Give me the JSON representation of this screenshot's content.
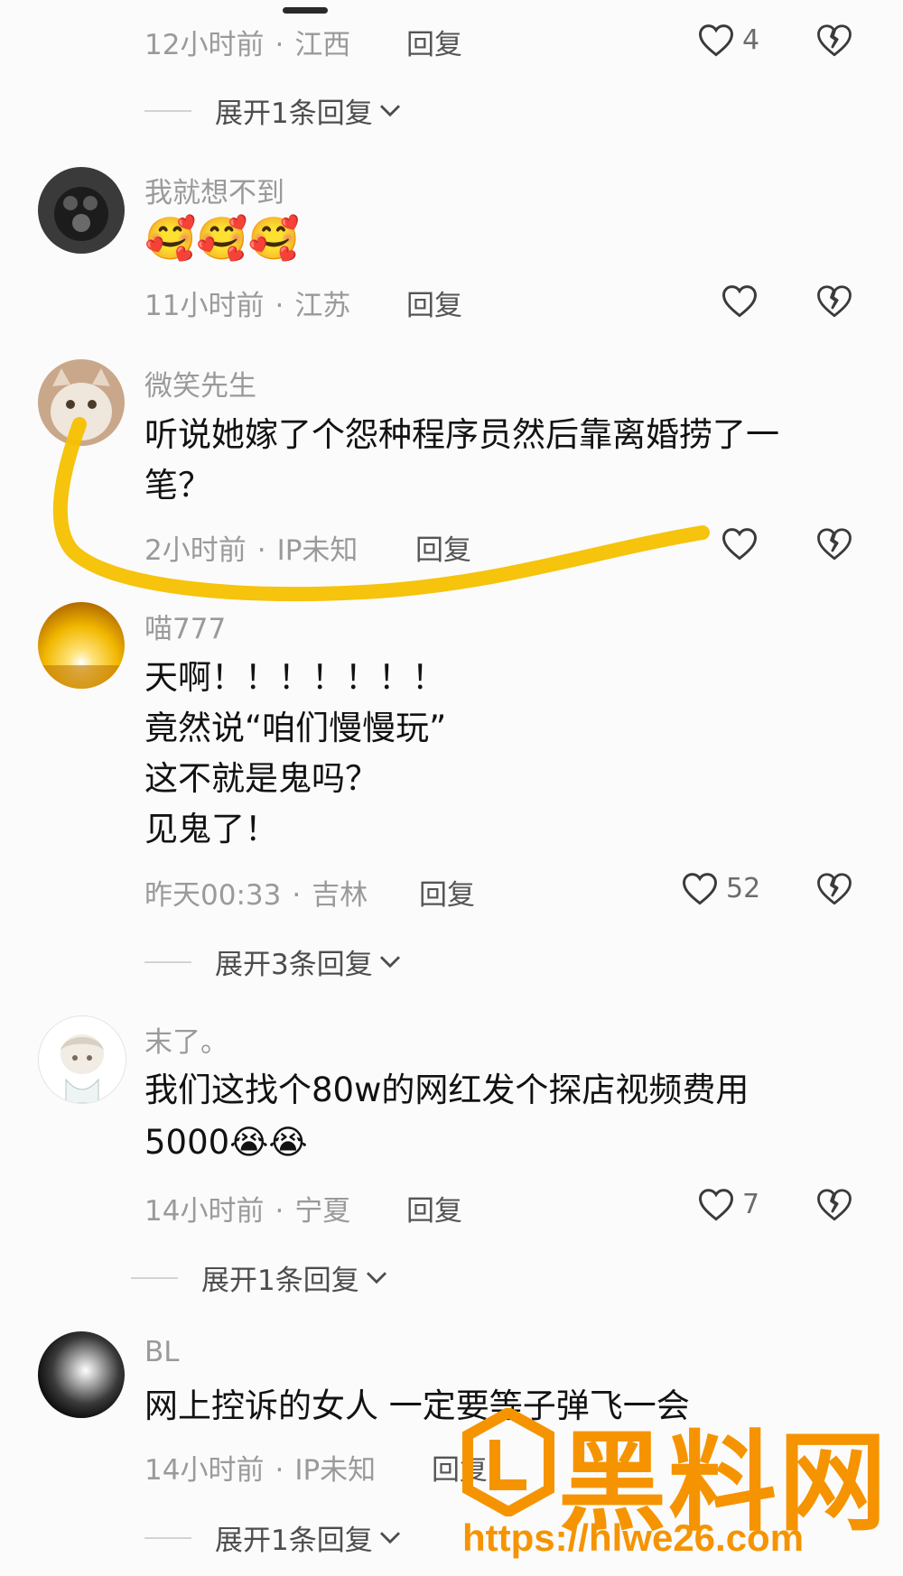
{
  "colors": {
    "accent_annotation": "#f6c000",
    "watermark": "#f59400"
  },
  "comments": [
    {
      "id": "c0",
      "time": "12小时前",
      "location": "江西",
      "reply": "回复",
      "likes": "4",
      "expand": "展开1条回复"
    },
    {
      "id": "c1",
      "name": "我就想不到",
      "text": [
        "🥰🥰🥰"
      ],
      "time": "11小时前",
      "location": "江苏",
      "reply": "回复",
      "likes": ""
    },
    {
      "id": "c2",
      "name": "微笑先生",
      "text": [
        "听说她嫁了个怨种程序员然后靠离婚捞了一",
        "笔？"
      ],
      "time": "2小时前",
      "location": "IP未知",
      "reply": "回复",
      "likes": ""
    },
    {
      "id": "c3",
      "name": "喵777",
      "text": [
        "天啊！！！！！！！",
        "竟然说“咱们慢慢玩”",
        "这不就是鬼吗？",
        "见鬼了！"
      ],
      "time": "昨天00:33",
      "location": "吉林",
      "reply": "回复",
      "likes": "52",
      "expand": "展开3条回复"
    },
    {
      "id": "c4",
      "name": "末了。",
      "text": [
        "我们这找个80w的网红发个探店视频费用",
        "5000😭😭"
      ],
      "time": "14小时前",
      "location": "宁夏",
      "reply": "回复",
      "likes": "7",
      "expand": "展开1条回复"
    },
    {
      "id": "c5",
      "name": "BL",
      "text": [
        "网上控诉的女人 一定要等子弹飞一会"
      ],
      "time": "14小时前",
      "location": "IP未知",
      "reply": "回复",
      "likes": "",
      "expand": "展开1条回复"
    }
  ],
  "watermark": {
    "text": "黑料网",
    "url": "https://hlwe26.com"
  }
}
